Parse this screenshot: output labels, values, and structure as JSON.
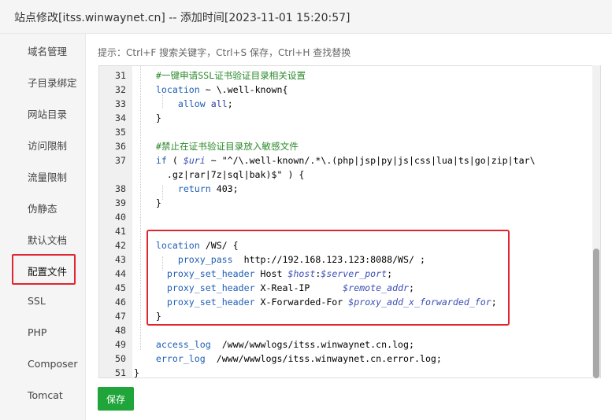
{
  "window": {
    "title": "站点修改[itss.winwaynet.cn] -- 添加时间[2023-11-01 15:20:57]"
  },
  "sidebar": {
    "items": [
      {
        "label": "域名管理"
      },
      {
        "label": "子目录绑定"
      },
      {
        "label": "网站目录"
      },
      {
        "label": "访问限制"
      },
      {
        "label": "流量限制"
      },
      {
        "label": "伪静态"
      },
      {
        "label": "默认文档"
      },
      {
        "label": "配置文件",
        "active": true
      },
      {
        "label": "SSL"
      },
      {
        "label": "PHP"
      },
      {
        "label": "Composer"
      },
      {
        "label": "Tomcat"
      }
    ]
  },
  "editor": {
    "hint": "提示：Ctrl+F 搜索关键字，Ctrl+S 保存，Ctrl+H 查找替换",
    "lines": [
      {
        "n": "31",
        "segs": [
          {
            "t": "    "
          },
          {
            "t": "#一键申请SSL证书验证目录相关设置",
            "c": "c"
          }
        ]
      },
      {
        "n": "32",
        "segs": [
          {
            "t": "    "
          },
          {
            "t": "location",
            "c": "k"
          },
          {
            "t": " ~ \\.well-known{"
          }
        ]
      },
      {
        "n": "33",
        "segs": [
          {
            "t": "        "
          },
          {
            "t": "allow",
            "c": "k"
          },
          {
            "t": " "
          },
          {
            "t": "all",
            "c": "s"
          },
          {
            "t": ";"
          }
        ]
      },
      {
        "n": "34",
        "segs": [
          {
            "t": "    }"
          }
        ]
      },
      {
        "n": "35",
        "segs": [
          {
            "t": ""
          }
        ]
      },
      {
        "n": "36",
        "segs": [
          {
            "t": "    "
          },
          {
            "t": "#禁止在证书验证目录放入敏感文件",
            "c": "c"
          }
        ]
      },
      {
        "n": "37",
        "segs": [
          {
            "t": "    "
          },
          {
            "t": "if",
            "c": "k"
          },
          {
            "t": " ( "
          },
          {
            "t": "$uri",
            "c": "v"
          },
          {
            "t": " ~ \"^/\\.well-known/.*\\.(php|jsp|py|js|css|lua|ts|go|zip|tar\\"
          }
        ]
      },
      {
        "n": "",
        "segs": [
          {
            "t": "      .gz|rar|7z|sql|bak)$\" ) {"
          }
        ]
      },
      {
        "n": "38",
        "segs": [
          {
            "t": "        "
          },
          {
            "t": "return",
            "c": "k"
          },
          {
            "t": " 403;"
          }
        ]
      },
      {
        "n": "39",
        "segs": [
          {
            "t": "    }"
          }
        ]
      },
      {
        "n": "40",
        "segs": [
          {
            "t": ""
          }
        ]
      },
      {
        "n": "41",
        "segs": [
          {
            "t": ""
          }
        ]
      },
      {
        "n": "42",
        "segs": [
          {
            "t": "    "
          },
          {
            "t": "location",
            "c": "k"
          },
          {
            "t": " /WS/ {"
          }
        ]
      },
      {
        "n": "43",
        "segs": [
          {
            "t": "        "
          },
          {
            "t": "proxy_pass",
            "c": "k"
          },
          {
            "t": "  http://192.168.123.123:8088/WS/ ;"
          }
        ]
      },
      {
        "n": "44",
        "segs": [
          {
            "t": "      "
          },
          {
            "t": "proxy_set_header",
            "c": "k"
          },
          {
            "t": " Host "
          },
          {
            "t": "$host",
            "c": "v"
          },
          {
            "t": ":"
          },
          {
            "t": "$server_port",
            "c": "v"
          },
          {
            "t": ";"
          }
        ]
      },
      {
        "n": "45",
        "segs": [
          {
            "t": "      "
          },
          {
            "t": "proxy_set_header",
            "c": "k"
          },
          {
            "t": " X-Real-IP      "
          },
          {
            "t": "$remote_addr",
            "c": "v"
          },
          {
            "t": ";"
          }
        ]
      },
      {
        "n": "46",
        "segs": [
          {
            "t": "      "
          },
          {
            "t": "proxy_set_header",
            "c": "k"
          },
          {
            "t": " X-Forwarded-For "
          },
          {
            "t": "$proxy_add_x_forwarded_for",
            "c": "v"
          },
          {
            "t": ";"
          }
        ]
      },
      {
        "n": "47",
        "segs": [
          {
            "t": "    }"
          }
        ]
      },
      {
        "n": "48",
        "segs": [
          {
            "t": ""
          }
        ]
      },
      {
        "n": "49",
        "segs": [
          {
            "t": "    "
          },
          {
            "t": "access_log",
            "c": "k"
          },
          {
            "t": "  /www/wwwlogs/itss.winwaynet.cn.log;"
          }
        ]
      },
      {
        "n": "50",
        "segs": [
          {
            "t": "    "
          },
          {
            "t": "error_log",
            "c": "k"
          },
          {
            "t": "  /www/wwwlogs/itss.winwaynet.cn.error.log;"
          }
        ]
      },
      {
        "n": "51",
        "segs": [
          {
            "t": "}"
          }
        ]
      }
    ]
  },
  "buttons": {
    "save": "保存"
  },
  "colors": {
    "accent": "#20a53a",
    "highlight": "#e0262f",
    "keyword": "#1f5fb4",
    "comment": "#2b8a2b",
    "variable": "#3b4fb5"
  }
}
